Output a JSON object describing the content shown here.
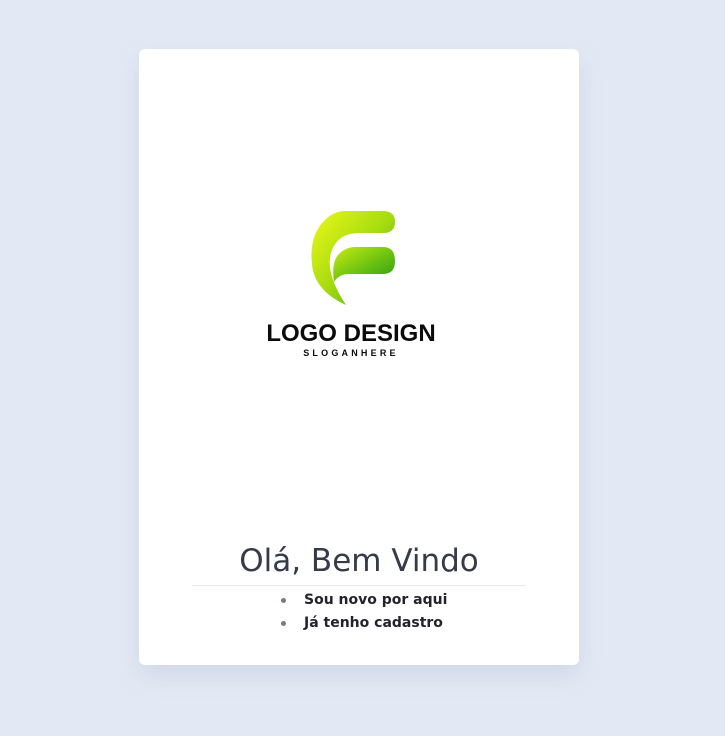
{
  "logo": {
    "wordmark": "LOGO DESIGN",
    "slogan": "SLOGANHERE",
    "colors": {
      "gradient_light": "#e6f70f",
      "gradient_mid": "#8fd10f",
      "gradient_dark": "#2a9a12",
      "text": "#0b0b0b"
    }
  },
  "welcome": {
    "title": "Olá, Bem Vindo"
  },
  "options": [
    {
      "label": "Sou novo por aqui"
    },
    {
      "label": "Já tenho cadastro"
    }
  ],
  "colors": {
    "background": "#e3e9f4",
    "card": "#ffffff",
    "title": "#373a4a"
  }
}
